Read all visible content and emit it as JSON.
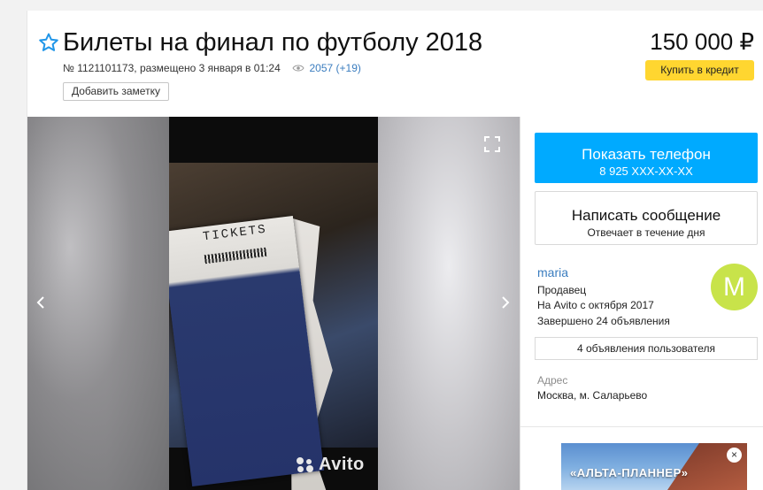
{
  "listing": {
    "title": "Билеты на финал по футболу 2018",
    "meta_prefix": "№ 1121101173, размещено 3 января в 01:24",
    "views": "2057 (+19)",
    "add_note_label": "Добавить заметку",
    "price": "150 000 ₽",
    "credit_label": "Купить в кредит"
  },
  "gallery": {
    "ticket_text": "TICKETS",
    "watermark": "Avito"
  },
  "contact": {
    "phone_label": "Показать телефон",
    "phone_number": "8 925 XXX-XX-XX",
    "message_label": "Написать сообщение",
    "message_sub": "Отвечает в течение дня"
  },
  "seller": {
    "name": "maria",
    "role": "Продавец",
    "since": "На Avito с октября 2017",
    "completed": "Завершено 24 объявления",
    "avatar_letter": "M",
    "ads_button": "4 объявления пользователя"
  },
  "address": {
    "label": "Адрес",
    "value": "Москва, м. Саларьево"
  },
  "banner": {
    "text": "«АЛЬТА-ПЛАННЕР»",
    "close": "×"
  },
  "colors": {
    "phone_button": "#00aaff",
    "credit_button": "#ffd630",
    "link": "#3b7dbf",
    "avatar": "#c8e34a"
  },
  "icons": [
    "star-icon",
    "eye-icon",
    "fullscreen-icon",
    "arrow-left-icon",
    "arrow-right-icon",
    "close-icon"
  ]
}
